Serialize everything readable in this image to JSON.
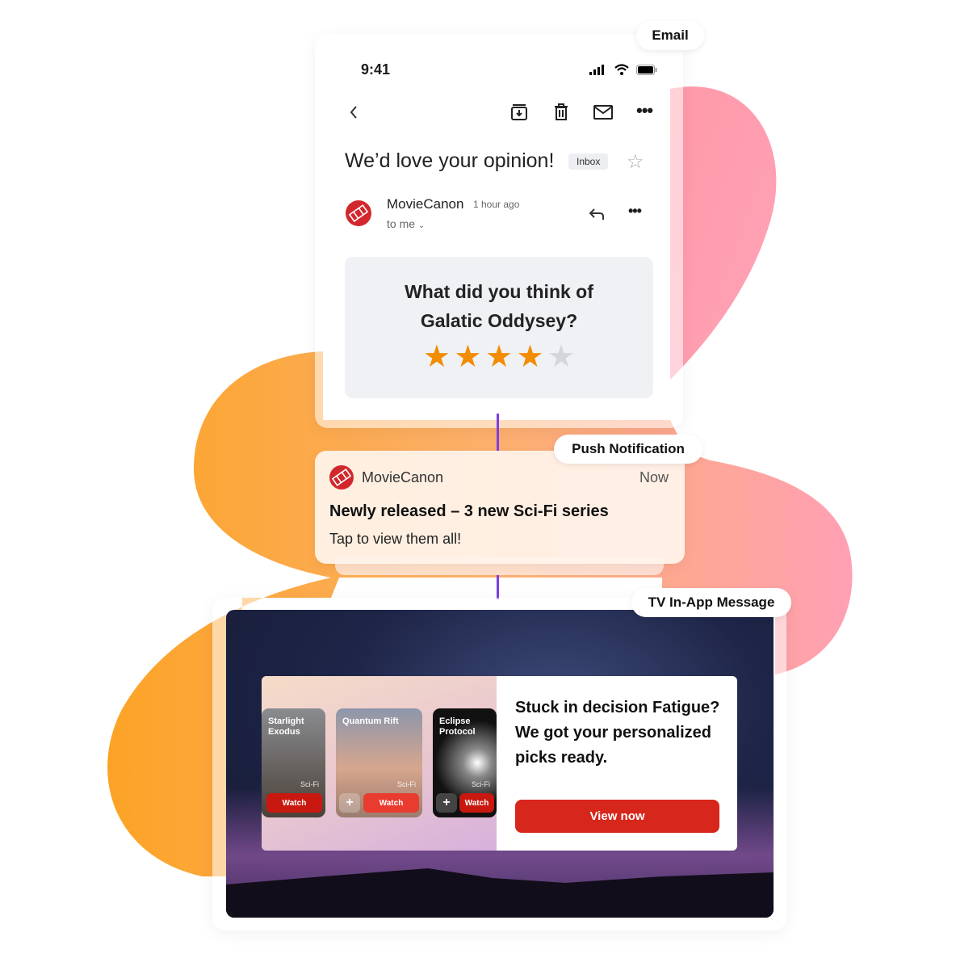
{
  "labels": {
    "email": "Email",
    "push": "Push Notification",
    "tv": "TV In-App Message"
  },
  "email": {
    "status_time": "9:41",
    "subject": "We’d love your opinion!",
    "inbox_label": "Inbox",
    "sender": "MovieCanon",
    "time_ago": "1 hour ago",
    "to": "to me",
    "question_line1": "What did you think of",
    "question_line2": "Galatic Oddysey?",
    "rating": 4,
    "rating_max": 5,
    "icons": [
      "back-chevron",
      "archive",
      "trash",
      "mail",
      "more",
      "star-outline",
      "reply"
    ]
  },
  "push": {
    "app": "MovieCanon",
    "time": "Now",
    "title": "Newly released – 3 new Sci-Fi series",
    "body": "Tap to view them all!"
  },
  "tv": {
    "cards": [
      {
        "title": "Starlight Exodus",
        "genre": "Sci-Fi",
        "button": "Watch"
      },
      {
        "title": "Quantum Rift",
        "genre": "Sci-Fi",
        "button": "Watch"
      },
      {
        "title": "Eclipse Protocol",
        "genre": "Sci-Fi",
        "button": "Watch"
      }
    ],
    "plus": "+",
    "headline": "Stuck in decision Fatigue? We got your personalized picks ready.",
    "cta": "View now"
  },
  "colors": {
    "accent": "#d7261b",
    "star": "#f28c00",
    "orange": "#fca326",
    "pink": "#ff9fb0",
    "connector": "#7b3fe4"
  }
}
